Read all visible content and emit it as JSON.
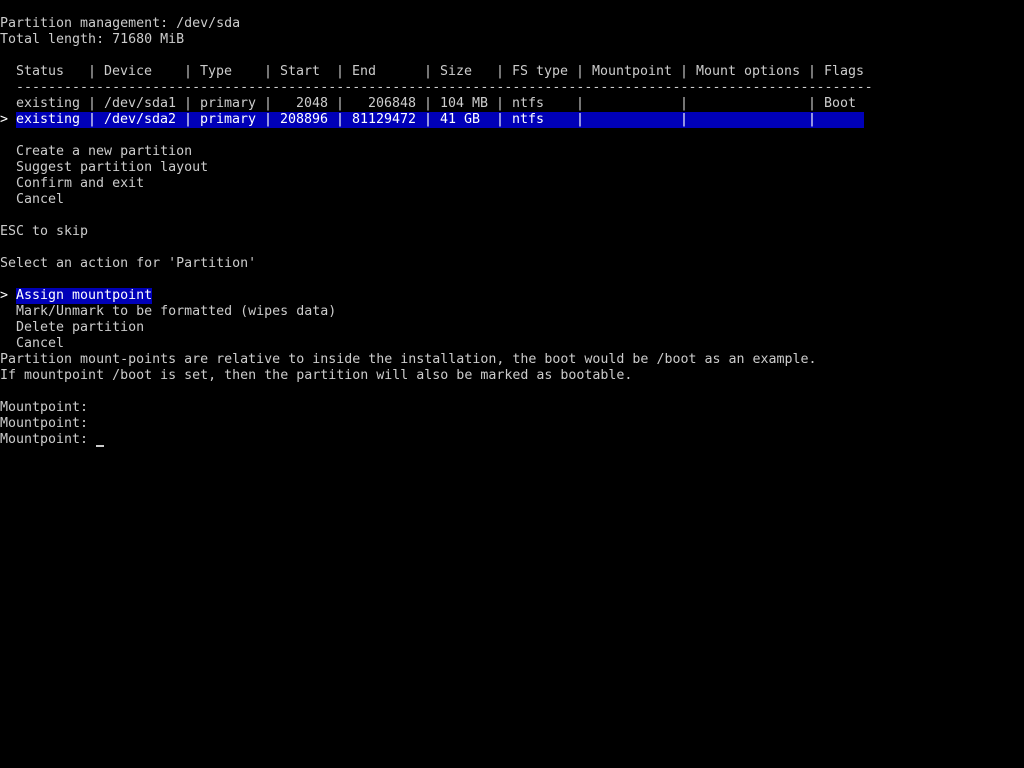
{
  "header": {
    "title": "Partition management: /dev/sda",
    "total_length": "Total length: 71680 MiB"
  },
  "table": {
    "columns": [
      "Status",
      "Device",
      "Type",
      "Start",
      "End",
      "Size",
      "FS type",
      "Mountpoint",
      "Mount options",
      "Flags"
    ],
    "separator": "-",
    "rows": [
      {
        "status": "existing",
        "device": "/dev/sda1",
        "type": "primary",
        "start": "2048",
        "end": "206848",
        "size": "104 MB",
        "fs": "ntfs",
        "mountpoint": "",
        "mount_options": "",
        "flags": "Boot",
        "selected": false
      },
      {
        "status": "existing",
        "device": "/dev/sda2",
        "type": "primary",
        "start": "208896",
        "end": "81129472",
        "size": "41 GB",
        "fs": "ntfs",
        "mountpoint": "",
        "mount_options": "",
        "flags": "",
        "selected": true
      }
    ]
  },
  "menu": {
    "items": [
      "Create a new partition",
      "Suggest partition layout",
      "Confirm and exit",
      "Cancel"
    ]
  },
  "esc_hint": "ESC to skip",
  "action_prompt": "Select an action for 'Partition'",
  "actions": {
    "items": [
      "Assign mountpoint",
      "Mark/Unmark to be formatted (wipes data)",
      "Delete partition",
      "Cancel"
    ],
    "selected_index": 0
  },
  "info": [
    "Partition mount-points are relative to inside the installation, the boot would be /boot as an example.",
    "If mountpoint /boot is set, then the partition will also be marked as bootable."
  ],
  "prompts": [
    {
      "label": "Mountpoint:",
      "value": ""
    },
    {
      "label": "Mountpoint:",
      "value": ""
    },
    {
      "label": "Mountpoint:",
      "value": ""
    }
  ],
  "caret_glyph": ">",
  "pipe_glyph": "|",
  "colors": {
    "background": "#000000",
    "text": "#cccccc",
    "highlight": "#0000b8",
    "highlight_text": "#ffffff"
  }
}
